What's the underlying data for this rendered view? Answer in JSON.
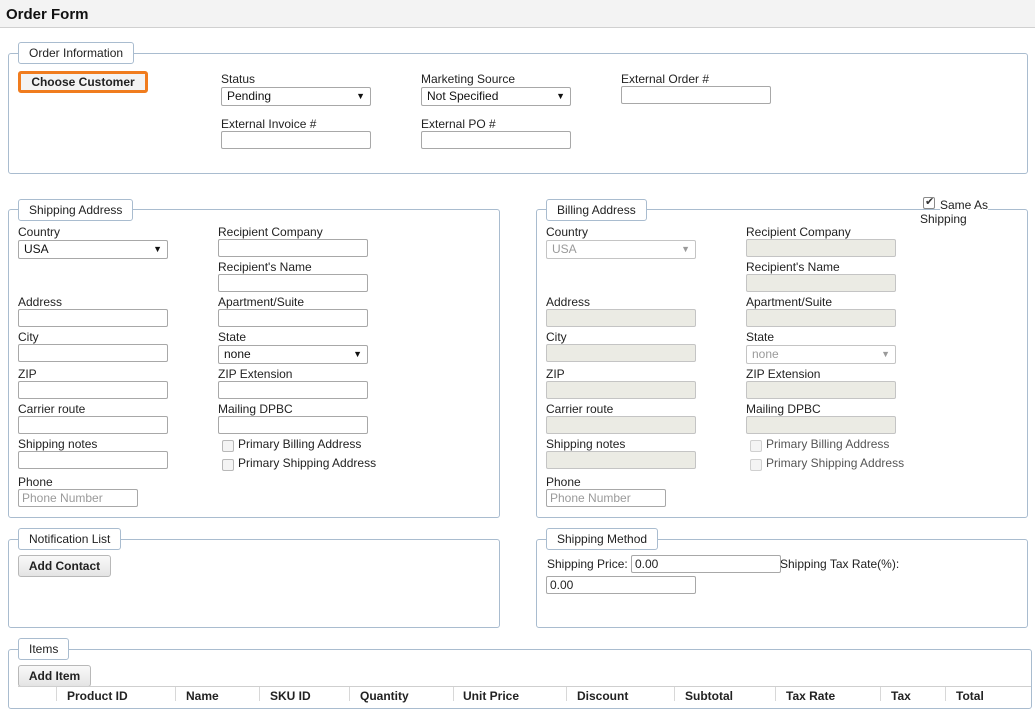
{
  "title": "Order Form",
  "order_info": {
    "legend": "Order Information",
    "choose_customer": "Choose Customer",
    "status_label": "Status",
    "status_value": "Pending",
    "marketing_label": "Marketing Source",
    "marketing_value": "Not Specified",
    "ext_order_label": "External Order #",
    "ext_order_value": "",
    "ext_invoice_label": "External Invoice #",
    "ext_invoice_value": "",
    "ext_po_label": "External PO #",
    "ext_po_value": ""
  },
  "shipping": {
    "legend": "Shipping Address",
    "country_label": "Country",
    "country_value": "USA",
    "company_label": "Recipient Company",
    "name_label": "Recipient's Name",
    "address_label": "Address",
    "apt_label": "Apartment/Suite",
    "city_label": "City",
    "state_label": "State",
    "state_value": "none",
    "zip_label": "ZIP",
    "zip_ext_label": "ZIP Extension",
    "carrier_label": "Carrier route",
    "dpbc_label": "Mailing DPBC",
    "notes_label": "Shipping notes",
    "primary_billing": "Primary Billing Address",
    "primary_shipping": "Primary Shipping Address",
    "phone_label": "Phone",
    "phone_placeholder": "Phone Number"
  },
  "billing": {
    "legend": "Billing Address",
    "same_as_line1": "Same As",
    "same_as_line2": "Shipping",
    "same_as_checked": true,
    "country_label": "Country",
    "country_value": "USA",
    "company_label": "Recipient Company",
    "name_label": "Recipient's Name",
    "address_label": "Address",
    "apt_label": "Apartment/Suite",
    "city_label": "City",
    "state_label": "State",
    "state_value": "none",
    "zip_label": "ZIP",
    "zip_ext_label": "ZIP Extension",
    "carrier_label": "Carrier route",
    "dpbc_label": "Mailing DPBC",
    "notes_label": "Shipping notes",
    "primary_billing": "Primary Billing Address",
    "primary_shipping": "Primary Shipping Address",
    "phone_label": "Phone",
    "phone_placeholder": "Phone Number"
  },
  "notification": {
    "legend": "Notification List",
    "add_contact": "Add Contact"
  },
  "shipping_method": {
    "legend": "Shipping Method",
    "price_label": "Shipping Price:",
    "price_value": "0.00",
    "tax_rate_label": "Shipping Tax Rate(%):",
    "tax_rate_value": "0.00"
  },
  "items": {
    "legend": "Items",
    "add_item": "Add Item",
    "columns": [
      "Product ID",
      "Name",
      "SKU ID",
      "Quantity",
      "Unit Price",
      "Discount",
      "Subtotal",
      "Tax Rate",
      "Tax",
      "Total"
    ]
  },
  "icons": {
    "select_arrow": "caret-down-icon",
    "checkmark": "checkmark-icon"
  }
}
